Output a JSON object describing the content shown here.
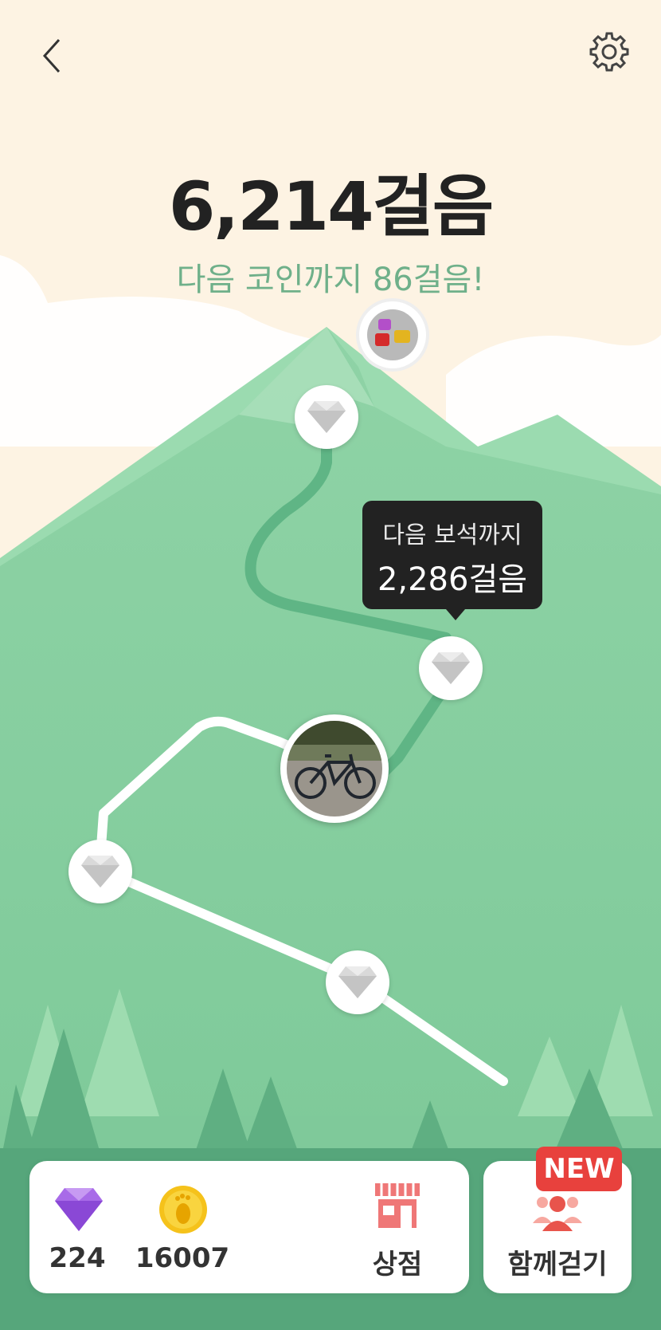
{
  "header": {
    "back_icon": "chevron-left-icon",
    "settings_icon": "gear-icon"
  },
  "steps": {
    "count": "6,214걸음",
    "next_coin": "다음 코인까지 86걸음!"
  },
  "tooltip": {
    "line1": "다음 보석까지",
    "line2": "2,286걸음"
  },
  "route": {
    "milestone_icon": "diamond-icon",
    "summit_reward_icon": "gift-boxes-icon",
    "current_photo_icon": "bicycle-photo"
  },
  "bottom_bar": {
    "gems": "224",
    "coins": "16007",
    "shop_label": "상점",
    "together_label": "함께걷기",
    "new_badge": "NEW"
  },
  "colors": {
    "sky": "#fdf3e3",
    "mountain": "#7fcb9a",
    "path_done": "#5fb585",
    "path_todo": "#ffffff",
    "accent_text": "#6fb08a",
    "badge": "#e8413d"
  }
}
